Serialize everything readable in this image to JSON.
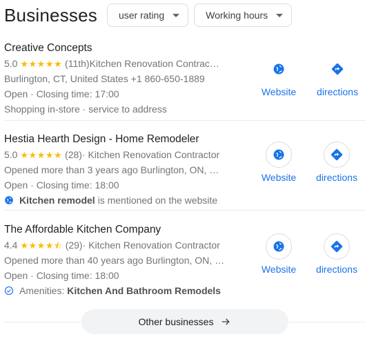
{
  "header": {
    "title": "Businesses",
    "filters": [
      {
        "label": "user rating"
      },
      {
        "label": "Working hours"
      }
    ]
  },
  "listings": [
    {
      "name": "Creative Concepts",
      "rating": "5.0",
      "stars": "★★★★★",
      "category": "(11th)Kitchen Renovation Contrac…",
      "address": "Burlington, CT, United States +1 860-650-1889",
      "hours": "Open · Closing time: 17:00",
      "extra": "Shopping in-store · service to address",
      "website_label": "Website",
      "directions_label": "directions"
    },
    {
      "name": "Hestia Hearth Design - Home Remodeler",
      "rating": "5.0",
      "stars": "★★★★★",
      "category": "(28)· Kitchen Renovation Contractor",
      "address": "Opened more than 3 years ago Burlington, ON, …",
      "hours": "Open · Closing time: 18:00",
      "mention_bold": "Kitchen remodel",
      "mention_rest": " is mentioned on the website",
      "website_label": "Website",
      "directions_label": "directions"
    },
    {
      "name": "The Affordable Kitchen Company",
      "rating": "4.4",
      "stars": "★★★★⯪",
      "category": "(29)· Kitchen Renovation Contractor",
      "address": "Opened more than 40 years ago Burlington, ON, …",
      "hours": "Open · Closing time: 18:00",
      "amenities_prefix": "Amenities: ",
      "amenities_bold": "Kitchen And Bathroom Remodels",
      "website_label": "Website",
      "directions_label": "directions"
    }
  ],
  "footer": {
    "other_label": "Other businesses"
  },
  "colors": {
    "accent": "#1a73e8",
    "star": "#fbbc04",
    "muted": "#70757a"
  }
}
